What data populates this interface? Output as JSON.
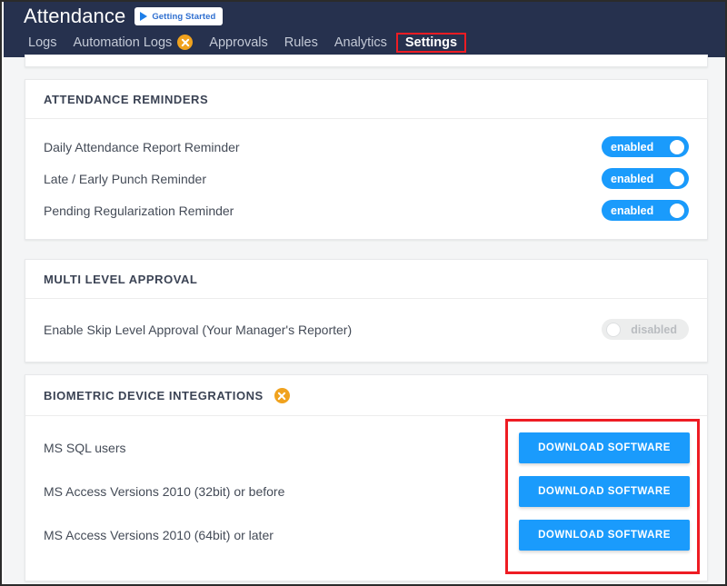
{
  "header": {
    "app_title": "Attendance",
    "getting_started": {
      "label": "Getting Started",
      "icon": "play-icon"
    },
    "nav": [
      {
        "label": "Logs",
        "active": false,
        "badge": null
      },
      {
        "label": "Automation Logs",
        "active": false,
        "badge": "plane-icon"
      },
      {
        "label": "Approvals",
        "active": false,
        "badge": null
      },
      {
        "label": "Rules",
        "active": false,
        "badge": null
      },
      {
        "label": "Analytics",
        "active": false,
        "badge": null
      },
      {
        "label": "Settings",
        "active": true,
        "badge": null
      }
    ]
  },
  "sections": {
    "attendance_reminders": {
      "title": "ATTENDANCE REMINDERS",
      "rows": [
        {
          "label": "Daily Attendance Report Reminder",
          "toggle": "enabled"
        },
        {
          "label": "Late / Early Punch Reminder",
          "toggle": "enabled"
        },
        {
          "label": "Pending Regularization Reminder",
          "toggle": "enabled"
        }
      ]
    },
    "multi_level_approval": {
      "title": "MULTI LEVEL APPROVAL",
      "rows": [
        {
          "label": "Enable Skip Level Approval (Your Manager's Reporter)",
          "toggle": "disabled"
        }
      ]
    },
    "biometric_device_integrations": {
      "title": "BIOMETRIC DEVICE INTEGRATIONS",
      "badge_icon": "plane-icon",
      "rows": [
        {
          "label": "MS SQL users",
          "button": "DOWNLOAD SOFTWARE"
        },
        {
          "label": "MS Access Versions 2010 (32bit) or before",
          "button": "DOWNLOAD SOFTWARE"
        },
        {
          "label": "MS Access Versions 2010 (64bit) or later",
          "button": "DOWNLOAD SOFTWARE"
        }
      ]
    }
  },
  "colors": {
    "navbar": "#26314e",
    "accent_blue": "#1a9bfc",
    "badge_orange": "#f0a21e",
    "annotation_red": "#ee1c23",
    "page_background": "#f4f5f6"
  }
}
